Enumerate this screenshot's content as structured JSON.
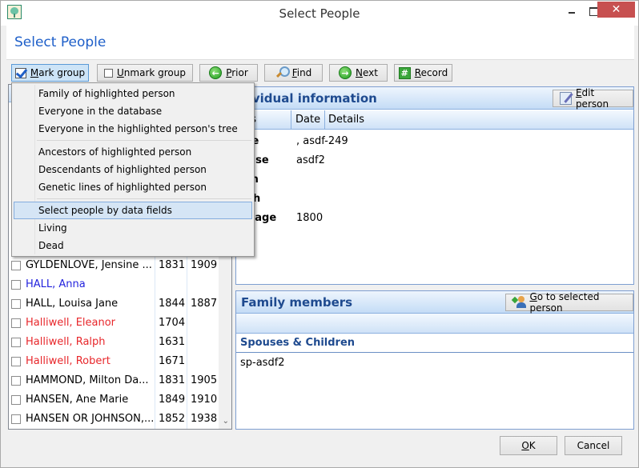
{
  "window": {
    "title": "Select People",
    "controls": {
      "minimize": "minimize",
      "maximize": "maximize",
      "close": "✕"
    }
  },
  "header": {
    "title": "Select People"
  },
  "toolbar": {
    "mark_group": {
      "label": "Mark group",
      "mnemonic": "M",
      "rest": "ark group"
    },
    "unmark_group": {
      "label": "Unmark group",
      "mnemonic": "U",
      "rest": "nmark group"
    },
    "prior": {
      "label": "Prior",
      "mnemonic": "P",
      "rest": "rior"
    },
    "find": {
      "label": "Find",
      "mnemonic": "F",
      "rest": "ind"
    },
    "next": {
      "label": "Next",
      "mnemonic": "N",
      "rest": "ext"
    },
    "record": {
      "label": "Record",
      "mnemonic": "R",
      "rest": "ecord"
    }
  },
  "mark_group_menu": {
    "items": [
      "Family of highlighted person",
      "Everyone in the database",
      "Everyone in the highlighted person's tree",
      "Ancestors of highlighted person",
      "Descendants of highlighted person",
      "Genetic lines of highlighted person",
      "Select people by data fields",
      "Living",
      "Dead"
    ],
    "highlighted": "Select people by data fields"
  },
  "people_list": {
    "rows": [
      {
        "name": "GYLDENLOVE, Jensine ...",
        "birth": "1831",
        "death": "1909",
        "color": "black",
        "checked": false
      },
      {
        "name": "HALL, Anna",
        "birth": "",
        "death": "",
        "color": "blue",
        "checked": false
      },
      {
        "name": "HALL, Louisa Jane",
        "birth": "1844",
        "death": "1887",
        "color": "black",
        "checked": false
      },
      {
        "name": "Halliwell, Eleanor",
        "birth": "1704",
        "death": "",
        "color": "red",
        "checked": false
      },
      {
        "name": "Halliwell, Ralph",
        "birth": "1631",
        "death": "",
        "color": "red",
        "checked": false
      },
      {
        "name": "Halliwell, Robert",
        "birth": "1671",
        "death": "",
        "color": "red",
        "checked": false
      },
      {
        "name": "HAMMOND, Milton Da...",
        "birth": "1831",
        "death": "1905",
        "color": "black",
        "checked": false
      },
      {
        "name": "HANSEN, Ane Marie",
        "birth": "1849",
        "death": "1910",
        "color": "black",
        "checked": false
      },
      {
        "name": "HANSEN OR JOHNSON,...",
        "birth": "1852",
        "death": "1938",
        "color": "black",
        "checked": false
      }
    ]
  },
  "individual_info": {
    "title": "Individual information",
    "title_visible": "dividual information",
    "edit_button": {
      "label": "Edit person",
      "mnemonic": "E",
      "rest": "dit person"
    },
    "columns": {
      "facts_visible": "cts",
      "facts": "Facts",
      "date": "Date",
      "details": "Details"
    },
    "facts": [
      {
        "label_visible": "me",
        "label": "Name",
        "value": ", asdf-249"
      },
      {
        "label_visible": "ouse",
        "label": "Spouse",
        "value": "asdf2"
      },
      {
        "label_visible": "rth",
        "label": "Birth",
        "value": ""
      },
      {
        "label_visible": "ath",
        "label": "Death",
        "value": ""
      },
      {
        "label_visible": "rriage",
        "label": "Marriage",
        "value": "1800"
      }
    ]
  },
  "family_members": {
    "title": "Family members",
    "goto_button": {
      "label": "Go to selected person",
      "mnemonic": "G",
      "rest": "o to selected person"
    },
    "section_title": "Spouses & Children",
    "items": [
      "sp-asdf2"
    ]
  },
  "footer": {
    "ok": {
      "label": "OK",
      "mnemonic": "O",
      "rest": "K"
    },
    "cancel": {
      "label": "Cancel"
    }
  },
  "colors": {
    "accent": "#1e5fc9",
    "panel_title": "#1e4a8f",
    "name_blue": "#2222dd",
    "name_red": "#e8272b",
    "close_button": "#c75050",
    "menu_highlight": "#d5e5f5"
  }
}
